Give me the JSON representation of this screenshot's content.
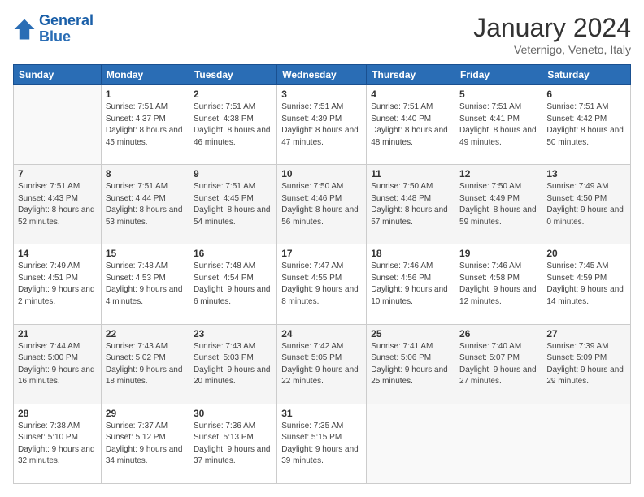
{
  "logo": {
    "line1": "General",
    "line2": "Blue"
  },
  "title": "January 2024",
  "location": "Veternigo, Veneto, Italy",
  "headers": [
    "Sunday",
    "Monday",
    "Tuesday",
    "Wednesday",
    "Thursday",
    "Friday",
    "Saturday"
  ],
  "weeks": [
    [
      {
        "day": "",
        "sunrise": "",
        "sunset": "",
        "daylight": ""
      },
      {
        "day": "1",
        "sunrise": "Sunrise: 7:51 AM",
        "sunset": "Sunset: 4:37 PM",
        "daylight": "Daylight: 8 hours and 45 minutes."
      },
      {
        "day": "2",
        "sunrise": "Sunrise: 7:51 AM",
        "sunset": "Sunset: 4:38 PM",
        "daylight": "Daylight: 8 hours and 46 minutes."
      },
      {
        "day": "3",
        "sunrise": "Sunrise: 7:51 AM",
        "sunset": "Sunset: 4:39 PM",
        "daylight": "Daylight: 8 hours and 47 minutes."
      },
      {
        "day": "4",
        "sunrise": "Sunrise: 7:51 AM",
        "sunset": "Sunset: 4:40 PM",
        "daylight": "Daylight: 8 hours and 48 minutes."
      },
      {
        "day": "5",
        "sunrise": "Sunrise: 7:51 AM",
        "sunset": "Sunset: 4:41 PM",
        "daylight": "Daylight: 8 hours and 49 minutes."
      },
      {
        "day": "6",
        "sunrise": "Sunrise: 7:51 AM",
        "sunset": "Sunset: 4:42 PM",
        "daylight": "Daylight: 8 hours and 50 minutes."
      }
    ],
    [
      {
        "day": "7",
        "sunrise": "Sunrise: 7:51 AM",
        "sunset": "Sunset: 4:43 PM",
        "daylight": "Daylight: 8 hours and 52 minutes."
      },
      {
        "day": "8",
        "sunrise": "Sunrise: 7:51 AM",
        "sunset": "Sunset: 4:44 PM",
        "daylight": "Daylight: 8 hours and 53 minutes."
      },
      {
        "day": "9",
        "sunrise": "Sunrise: 7:51 AM",
        "sunset": "Sunset: 4:45 PM",
        "daylight": "Daylight: 8 hours and 54 minutes."
      },
      {
        "day": "10",
        "sunrise": "Sunrise: 7:50 AM",
        "sunset": "Sunset: 4:46 PM",
        "daylight": "Daylight: 8 hours and 56 minutes."
      },
      {
        "day": "11",
        "sunrise": "Sunrise: 7:50 AM",
        "sunset": "Sunset: 4:48 PM",
        "daylight": "Daylight: 8 hours and 57 minutes."
      },
      {
        "day": "12",
        "sunrise": "Sunrise: 7:50 AM",
        "sunset": "Sunset: 4:49 PM",
        "daylight": "Daylight: 8 hours and 59 minutes."
      },
      {
        "day": "13",
        "sunrise": "Sunrise: 7:49 AM",
        "sunset": "Sunset: 4:50 PM",
        "daylight": "Daylight: 9 hours and 0 minutes."
      }
    ],
    [
      {
        "day": "14",
        "sunrise": "Sunrise: 7:49 AM",
        "sunset": "Sunset: 4:51 PM",
        "daylight": "Daylight: 9 hours and 2 minutes."
      },
      {
        "day": "15",
        "sunrise": "Sunrise: 7:48 AM",
        "sunset": "Sunset: 4:53 PM",
        "daylight": "Daylight: 9 hours and 4 minutes."
      },
      {
        "day": "16",
        "sunrise": "Sunrise: 7:48 AM",
        "sunset": "Sunset: 4:54 PM",
        "daylight": "Daylight: 9 hours and 6 minutes."
      },
      {
        "day": "17",
        "sunrise": "Sunrise: 7:47 AM",
        "sunset": "Sunset: 4:55 PM",
        "daylight": "Daylight: 9 hours and 8 minutes."
      },
      {
        "day": "18",
        "sunrise": "Sunrise: 7:46 AM",
        "sunset": "Sunset: 4:56 PM",
        "daylight": "Daylight: 9 hours and 10 minutes."
      },
      {
        "day": "19",
        "sunrise": "Sunrise: 7:46 AM",
        "sunset": "Sunset: 4:58 PM",
        "daylight": "Daylight: 9 hours and 12 minutes."
      },
      {
        "day": "20",
        "sunrise": "Sunrise: 7:45 AM",
        "sunset": "Sunset: 4:59 PM",
        "daylight": "Daylight: 9 hours and 14 minutes."
      }
    ],
    [
      {
        "day": "21",
        "sunrise": "Sunrise: 7:44 AM",
        "sunset": "Sunset: 5:00 PM",
        "daylight": "Daylight: 9 hours and 16 minutes."
      },
      {
        "day": "22",
        "sunrise": "Sunrise: 7:43 AM",
        "sunset": "Sunset: 5:02 PM",
        "daylight": "Daylight: 9 hours and 18 minutes."
      },
      {
        "day": "23",
        "sunrise": "Sunrise: 7:43 AM",
        "sunset": "Sunset: 5:03 PM",
        "daylight": "Daylight: 9 hours and 20 minutes."
      },
      {
        "day": "24",
        "sunrise": "Sunrise: 7:42 AM",
        "sunset": "Sunset: 5:05 PM",
        "daylight": "Daylight: 9 hours and 22 minutes."
      },
      {
        "day": "25",
        "sunrise": "Sunrise: 7:41 AM",
        "sunset": "Sunset: 5:06 PM",
        "daylight": "Daylight: 9 hours and 25 minutes."
      },
      {
        "day": "26",
        "sunrise": "Sunrise: 7:40 AM",
        "sunset": "Sunset: 5:07 PM",
        "daylight": "Daylight: 9 hours and 27 minutes."
      },
      {
        "day": "27",
        "sunrise": "Sunrise: 7:39 AM",
        "sunset": "Sunset: 5:09 PM",
        "daylight": "Daylight: 9 hours and 29 minutes."
      }
    ],
    [
      {
        "day": "28",
        "sunrise": "Sunrise: 7:38 AM",
        "sunset": "Sunset: 5:10 PM",
        "daylight": "Daylight: 9 hours and 32 minutes."
      },
      {
        "day": "29",
        "sunrise": "Sunrise: 7:37 AM",
        "sunset": "Sunset: 5:12 PM",
        "daylight": "Daylight: 9 hours and 34 minutes."
      },
      {
        "day": "30",
        "sunrise": "Sunrise: 7:36 AM",
        "sunset": "Sunset: 5:13 PM",
        "daylight": "Daylight: 9 hours and 37 minutes."
      },
      {
        "day": "31",
        "sunrise": "Sunrise: 7:35 AM",
        "sunset": "Sunset: 5:15 PM",
        "daylight": "Daylight: 9 hours and 39 minutes."
      },
      {
        "day": "",
        "sunrise": "",
        "sunset": "",
        "daylight": ""
      },
      {
        "day": "",
        "sunrise": "",
        "sunset": "",
        "daylight": ""
      },
      {
        "day": "",
        "sunrise": "",
        "sunset": "",
        "daylight": ""
      }
    ]
  ]
}
